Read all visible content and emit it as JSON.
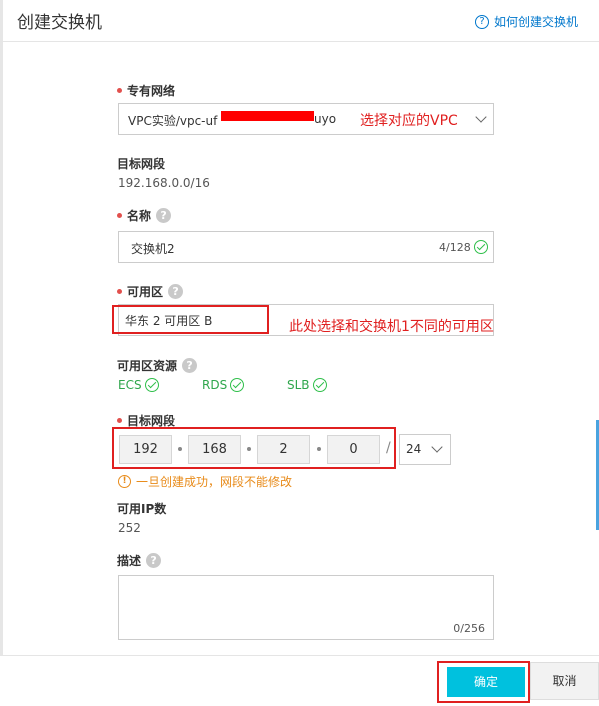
{
  "dialog": {
    "title": "创建交换机",
    "help_link": "如何创建交换机",
    "help_icon": "?"
  },
  "vpc": {
    "label": "专有网络",
    "value_prefix": "VPC实验/vpc-uf",
    "value_suffix": "uyo",
    "annotation": "选择对应的VPC"
  },
  "vpc_cidr": {
    "label": "目标网段",
    "value": "192.168.0.0/16"
  },
  "name": {
    "label": "名称",
    "value": "交换机2",
    "counter": "4/128"
  },
  "zone": {
    "label": "可用区",
    "value": "华东 2 可用区 B",
    "annotation": "此处选择和交换机1不同的可用区"
  },
  "zone_resources": {
    "label": "可用区资源",
    "items": [
      "ECS",
      "RDS",
      "SLB"
    ]
  },
  "cidr": {
    "label": "目标网段",
    "octets": [
      "192",
      "168",
      "2",
      "0"
    ],
    "slash": "/",
    "mask": "24",
    "warning": "一旦创建成功，网段不能修改",
    "warning_icon": "!"
  },
  "available_ips": {
    "label": "可用IP数",
    "value": "252"
  },
  "description": {
    "label": "描述",
    "counter": "0/256"
  },
  "footer": {
    "ok_label": "确定",
    "cancel_label": "取消"
  },
  "colors": {
    "accent": "#00c1de",
    "annotation_red": "#e02020",
    "success_green": "#2fa64c",
    "warning_orange": "#e88b1a",
    "link_blue": "#0077cc"
  }
}
